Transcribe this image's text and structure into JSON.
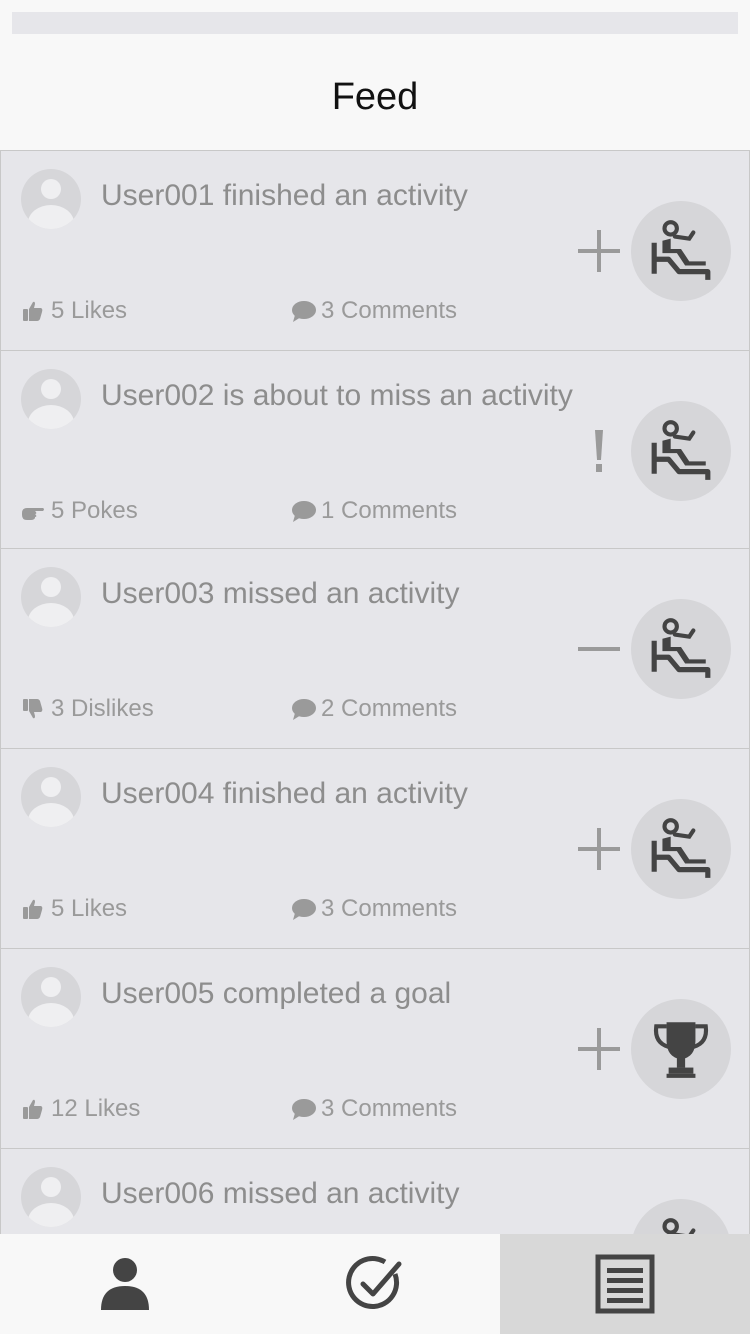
{
  "header": {
    "title": "Feed"
  },
  "feed": {
    "items": [
      {
        "headline": "User001 finished an activity",
        "reaction_text": "5 Likes",
        "reaction_icon": "thumbs-up-icon",
        "comments_text": "3 Comments",
        "status_icon": "plus-icon",
        "type_icon": "recliner-activity-icon"
      },
      {
        "headline": "User002 is about to miss an activity",
        "reaction_text": "5 Pokes",
        "reaction_icon": "poke-icon",
        "comments_text": "1 Comments",
        "status_icon": "exclamation-icon",
        "type_icon": "recliner-activity-icon"
      },
      {
        "headline": "User003 missed an activity",
        "reaction_text": "3 Dislikes",
        "reaction_icon": "thumbs-down-icon",
        "comments_text": "2 Comments",
        "status_icon": "minus-icon",
        "type_icon": "recliner-activity-icon"
      },
      {
        "headline": "User004 finished an activity",
        "reaction_text": "5 Likes",
        "reaction_icon": "thumbs-up-icon",
        "comments_text": "3 Comments",
        "status_icon": "plus-icon",
        "type_icon": "recliner-activity-icon"
      },
      {
        "headline": "User005 completed a goal",
        "reaction_text": "12 Likes",
        "reaction_icon": "thumbs-up-icon",
        "comments_text": "3 Comments",
        "status_icon": "plus-icon",
        "type_icon": "trophy-icon"
      },
      {
        "headline": "User006 missed an activity",
        "reaction_text": "",
        "reaction_icon": "",
        "comments_text": "",
        "status_icon": "",
        "type_icon": "recliner-activity-icon"
      }
    ]
  },
  "bottom_nav": {
    "tabs": [
      {
        "icon": "person-icon",
        "active": false
      },
      {
        "icon": "check-circle-icon",
        "active": false
      },
      {
        "icon": "list-icon",
        "active": true
      }
    ]
  },
  "colors": {
    "card_bg": "#e6e6ea",
    "muted_text": "#8d8d8d",
    "icon_dark": "#444444",
    "badge_bg": "#d6d6d9",
    "active_tab_bg": "#d8d8d8"
  }
}
